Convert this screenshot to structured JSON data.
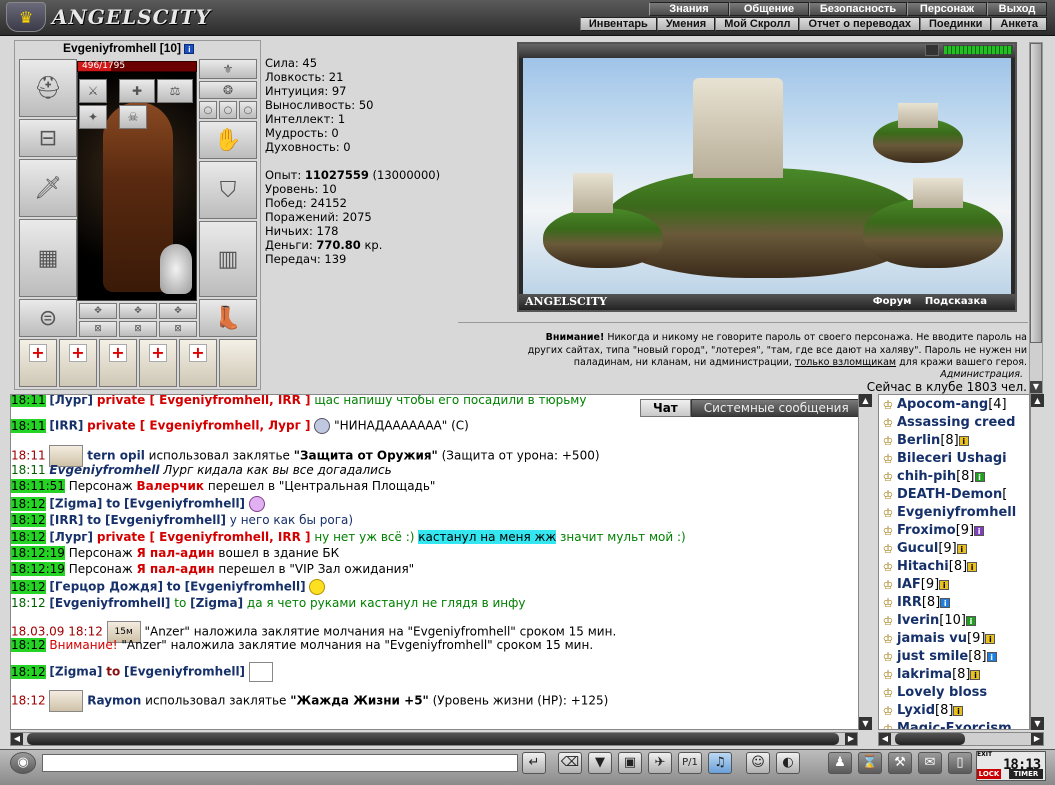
{
  "app": {
    "brand": "ANGELSCITY"
  },
  "menu": {
    "top": [
      "Знания",
      "Общение",
      "Безопасность",
      "Персонаж",
      "Выход"
    ],
    "sub": [
      "Инвентарь",
      "Умения",
      "Мой Скролл",
      "Отчет о переводах",
      "Поединки",
      "Анкета"
    ]
  },
  "character": {
    "name": "Evgeniyfromhell",
    "level": "[10]",
    "hp": "496/1795",
    "hp_fraction": 0.276
  },
  "stats": {
    "strength": "Сила: 45",
    "agility": "Ловкость: 21",
    "intuition": "Интуиция: 97",
    "endurance": "Выносливость: 50",
    "intellect": "Интеллект: 1",
    "wisdom": "Мудрость: 0",
    "spirit": "Духовность: 0",
    "exp_label": "Опыт: ",
    "exp_value": "11027559",
    "exp_next": " (13000000)",
    "level": "Уровень: 10",
    "wins": "Побед: 24152",
    "losses": "Поражений: 2075",
    "draws": "Ничьих: 178",
    "money_label": "Деньги: ",
    "money_value": "770.80",
    "money_unit": " кр.",
    "transfers": "Передач: 139"
  },
  "scene": {
    "brand": "ANGELSCITY",
    "link_forum": "Форум",
    "link_hint": "Подсказка"
  },
  "warning": {
    "bold": "Внимание!",
    "line1": " Никогда и никому не говорите пароль от своего персонажа. Не вводите пароль на",
    "line2": "других сайтах, типа \"новый город\", \"лотерея\", \"там, где все дают на халяву\". Пароль не нужен ни",
    "line3a": "паладинам, ни кланам, ни администрации, ",
    "line3u": "только взломщикам",
    "line3b": " для кражи вашего героя.",
    "signature": "Администрация."
  },
  "club_count": "Сейчас в клубе 1803 чел.",
  "chat_tabs": {
    "chat": "Чат",
    "system": "Системные сообщения"
  },
  "chat": {
    "m0": {
      "ts": "18:11",
      "nick": "[Лург]",
      "priv": "private [ Evgeniyfromhell, IRR ]",
      "text": " щас напишу чтобы его посадили в тюрьму"
    },
    "m1": {
      "ts": "18:11",
      "nick": "[IRR]",
      "priv": "private [ Evgeniyfromhell, Лург ]",
      "text": " \"НИНАДААААААА\" (С)"
    },
    "m2": {
      "ts": "18:11",
      "nick": "tern opil",
      "text1": " использовал заклятье ",
      "spell": "\"Защита от Оружия\"",
      "text2": " (Защита от урона: +500)"
    },
    "m3": {
      "ts": "18:11",
      "nick": "Evgeniyfromhell",
      "text": " Лург кидала как вы все догадались"
    },
    "m4": {
      "ts": "18:11:51",
      "pre": " Персонаж ",
      "who": "Валерчик",
      "text": " перешел в \"Центральная Площадь\""
    },
    "m5": {
      "ts": "18:12",
      "from": "[Zigma]",
      "to": "to",
      "target": "[Evgeniyfromhell]"
    },
    "m6": {
      "ts": "18:12",
      "from": "[IRR]",
      "to": "to",
      "target": "[Evgeniyfromhell]",
      "text": " у него как бы рога)"
    },
    "m7": {
      "ts": "18:12",
      "from": "[Лург]",
      "priv": "private [ Evgeniyfromhell, IRR ]",
      "text1": " ну нет уж всё :) ",
      "hl": "кастанул на меня жж",
      "text2": " значит мульт мой :)"
    },
    "m8": {
      "ts": "18:12:19",
      "pre": " Персонаж ",
      "who": "Я пал-адин",
      "text": " вошел в здание БК"
    },
    "m9": {
      "ts": "18:12:19",
      "pre": " Персонаж ",
      "who": "Я пал-адин",
      "text": " перешел в \"VIP Зал ожидания\""
    },
    "m10": {
      "ts": "18:12",
      "from": "[Герцор Дождя]",
      "to": "to",
      "target": "[Evgeniyfromhell]"
    },
    "m11": {
      "ts": "18:12",
      "from": "[Evgeniyfromhell]",
      "to": "to",
      "target": "[Zigma]",
      "text": " да я чето руками кастанул не глядя в инфу"
    },
    "m12": {
      "ts": "18.03.09 18:12",
      "icon_label": "15м",
      "text": " \"Anzer\" наложила заклятие молчания на \"Evgeniyfromhell\" сроком 15 мин."
    },
    "m13": {
      "ts": "18:12",
      "warn": "Внимание!",
      "text": " \"Anzer\" наложила заклятие молчания на \"Evgeniyfromhell\" сроком 15 мин."
    },
    "m14": {
      "ts": "18:12",
      "from": "[Zigma]",
      "to": "to",
      "target": "[Evgeniyfromhell]"
    },
    "m15": {
      "ts": "18:12",
      "nick": "Raymon",
      "text1": " использовал заклятье ",
      "spell": "\"Жажда Жизни +5\"",
      "text2": " (Уровень жизни (HP): +125)"
    }
  },
  "online": [
    {
      "name": "Apocom-ang",
      "lvl": "[4]"
    },
    {
      "name": "Assassing creed",
      "lvl": ""
    },
    {
      "name": "Berlin",
      "lvl": "[8]"
    },
    {
      "name": "Bileceri Ushagi",
      "lvl": ""
    },
    {
      "name": "chih-pih",
      "lvl": "[8]"
    },
    {
      "name": "DEATH-Demon",
      "lvl": "["
    },
    {
      "name": "Evgeniyfromhell",
      "lvl": ""
    },
    {
      "name": "Froximo",
      "lvl": "[9]"
    },
    {
      "name": "Gucul",
      "lvl": "[9]"
    },
    {
      "name": "Hitachi",
      "lvl": "[8]"
    },
    {
      "name": "IAF",
      "lvl": "[9]"
    },
    {
      "name": "IRR",
      "lvl": "[8]"
    },
    {
      "name": "Iverin",
      "lvl": "[10]"
    },
    {
      "name": "jamais vu",
      "lvl": "[9]"
    },
    {
      "name": "just smile",
      "lvl": "[8]"
    },
    {
      "name": "lakrima",
      "lvl": "[8]"
    },
    {
      "name": "Lovely bloss",
      "lvl": ""
    },
    {
      "name": "Lyxid",
      "lvl": "[8]"
    },
    {
      "name": "Magic-Exorcism",
      "lvl": ""
    }
  ],
  "input": {
    "value": ""
  },
  "clock": {
    "time": "18:13",
    "timer": "TIMER",
    "exit": "EXIT",
    "lock": "LOCK"
  }
}
